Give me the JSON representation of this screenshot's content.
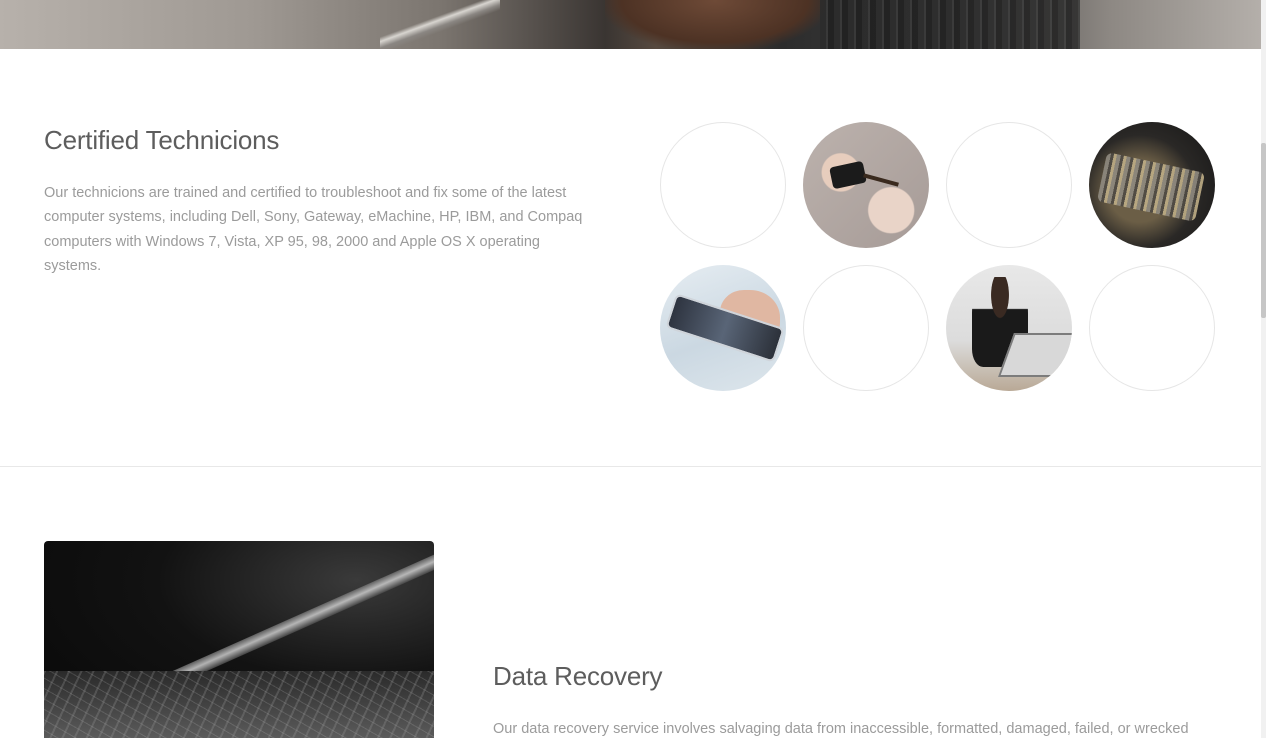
{
  "section_technicians": {
    "title": "Certified Technicions",
    "text": "Our technicions are trained and certified to troubleshoot and fix some of the latest computer systems, including Dell, Sony, Gateway, eMachine, HP, IBM, and Compaq computers with Windows 7, Vista, XP 95, 98, 2000 and Apple OS X operating systems."
  },
  "section_recovery": {
    "title": "Data Recovery",
    "text": "Our data recovery service involves salvaging data from inaccessible, formatted, damaged, failed, or wrecked"
  }
}
